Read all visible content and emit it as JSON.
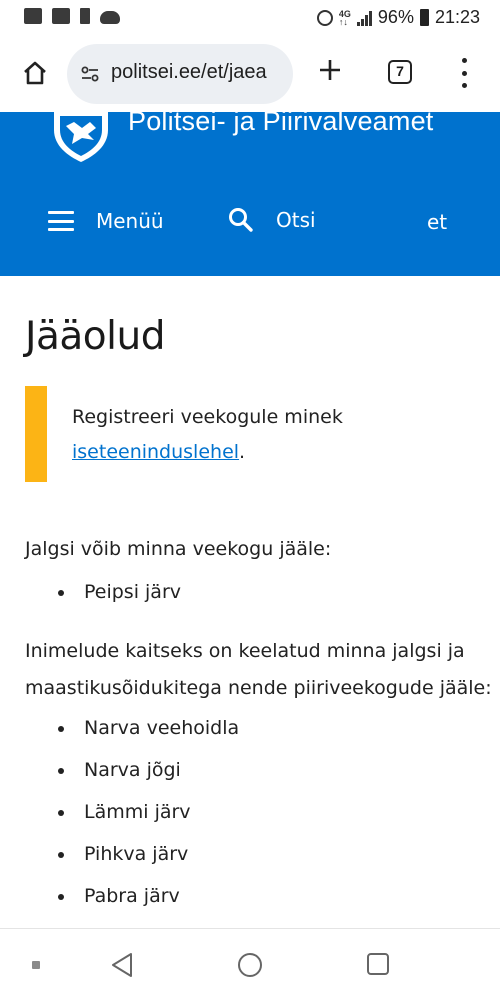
{
  "status_bar": {
    "battery_percent": "96%",
    "time": "21:23",
    "icons": [
      "gallery-icon",
      "activity-icon",
      "battery-saver-icon",
      "cloud-icon",
      "alarm-icon",
      "lte-icon",
      "signal-icon",
      "battery-icon"
    ]
  },
  "browser": {
    "url": "politsei.ee/et/jaea",
    "tab_count": "7",
    "icons": [
      "home-icon",
      "site-settings-icon",
      "new-tab-icon",
      "tab-switcher-icon",
      "more-menu-icon"
    ]
  },
  "header": {
    "site_name": "Politsei- ja Piirivalveamet",
    "menu_label": "Menüü",
    "search_label": "Otsi",
    "language": "et",
    "brand_color": "#0072ce"
  },
  "page": {
    "title": "Jääolud",
    "notice": {
      "text": "Registreeri veekogule minek ",
      "link": "iseteeninduslehel",
      "suffix": ".",
      "accent_color": "#fcb415"
    },
    "section1": {
      "intro": "Jalgsi võib minna veekogu jääle:",
      "items": [
        "Peipsi järv"
      ]
    },
    "section2": {
      "intro_line1": "Inimelude kaitseks on keelatud minna jalgsi ja",
      "intro_line2": "maastikusõidukitega nende piiriveekogude jääle:",
      "items": [
        "Narva veehoidla",
        "Narva jõgi",
        "Lämmi järv",
        "Pihkva järv",
        "Pabra järv"
      ]
    }
  },
  "nav_bar": {
    "buttons": [
      "back-icon",
      "home-circle-icon",
      "recents-icon"
    ]
  }
}
